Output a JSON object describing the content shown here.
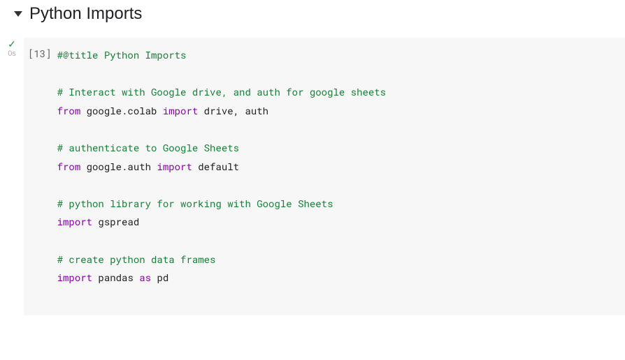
{
  "section": {
    "title": "Python Imports",
    "arrow_icon": "caret-down"
  },
  "cell": {
    "status_icon": "check",
    "exec_time": "0s",
    "exec_count": "[13]",
    "code": {
      "line1": {
        "text": "#@title Python Imports"
      },
      "line2": {
        "text": "# Interact with Google drive, and auth for google sheets"
      },
      "line3": {
        "kw1": "from",
        "mod1": " google.colab ",
        "kw2": "import",
        "mod2": " drive, auth"
      },
      "line4": {
        "text": "# authenticate to Google Sheets"
      },
      "line5": {
        "kw1": "from",
        "mod1": " google.auth ",
        "kw2": "import",
        "mod2": " default"
      },
      "line6": {
        "text": "# python library for working with Google Sheets"
      },
      "line7": {
        "kw1": "import",
        "mod1": " gspread"
      },
      "line8": {
        "text": "# create python data frames"
      },
      "line9": {
        "kw1": "import",
        "mod1": " pandas ",
        "kw2": "as",
        "mod2": " pd"
      }
    }
  }
}
